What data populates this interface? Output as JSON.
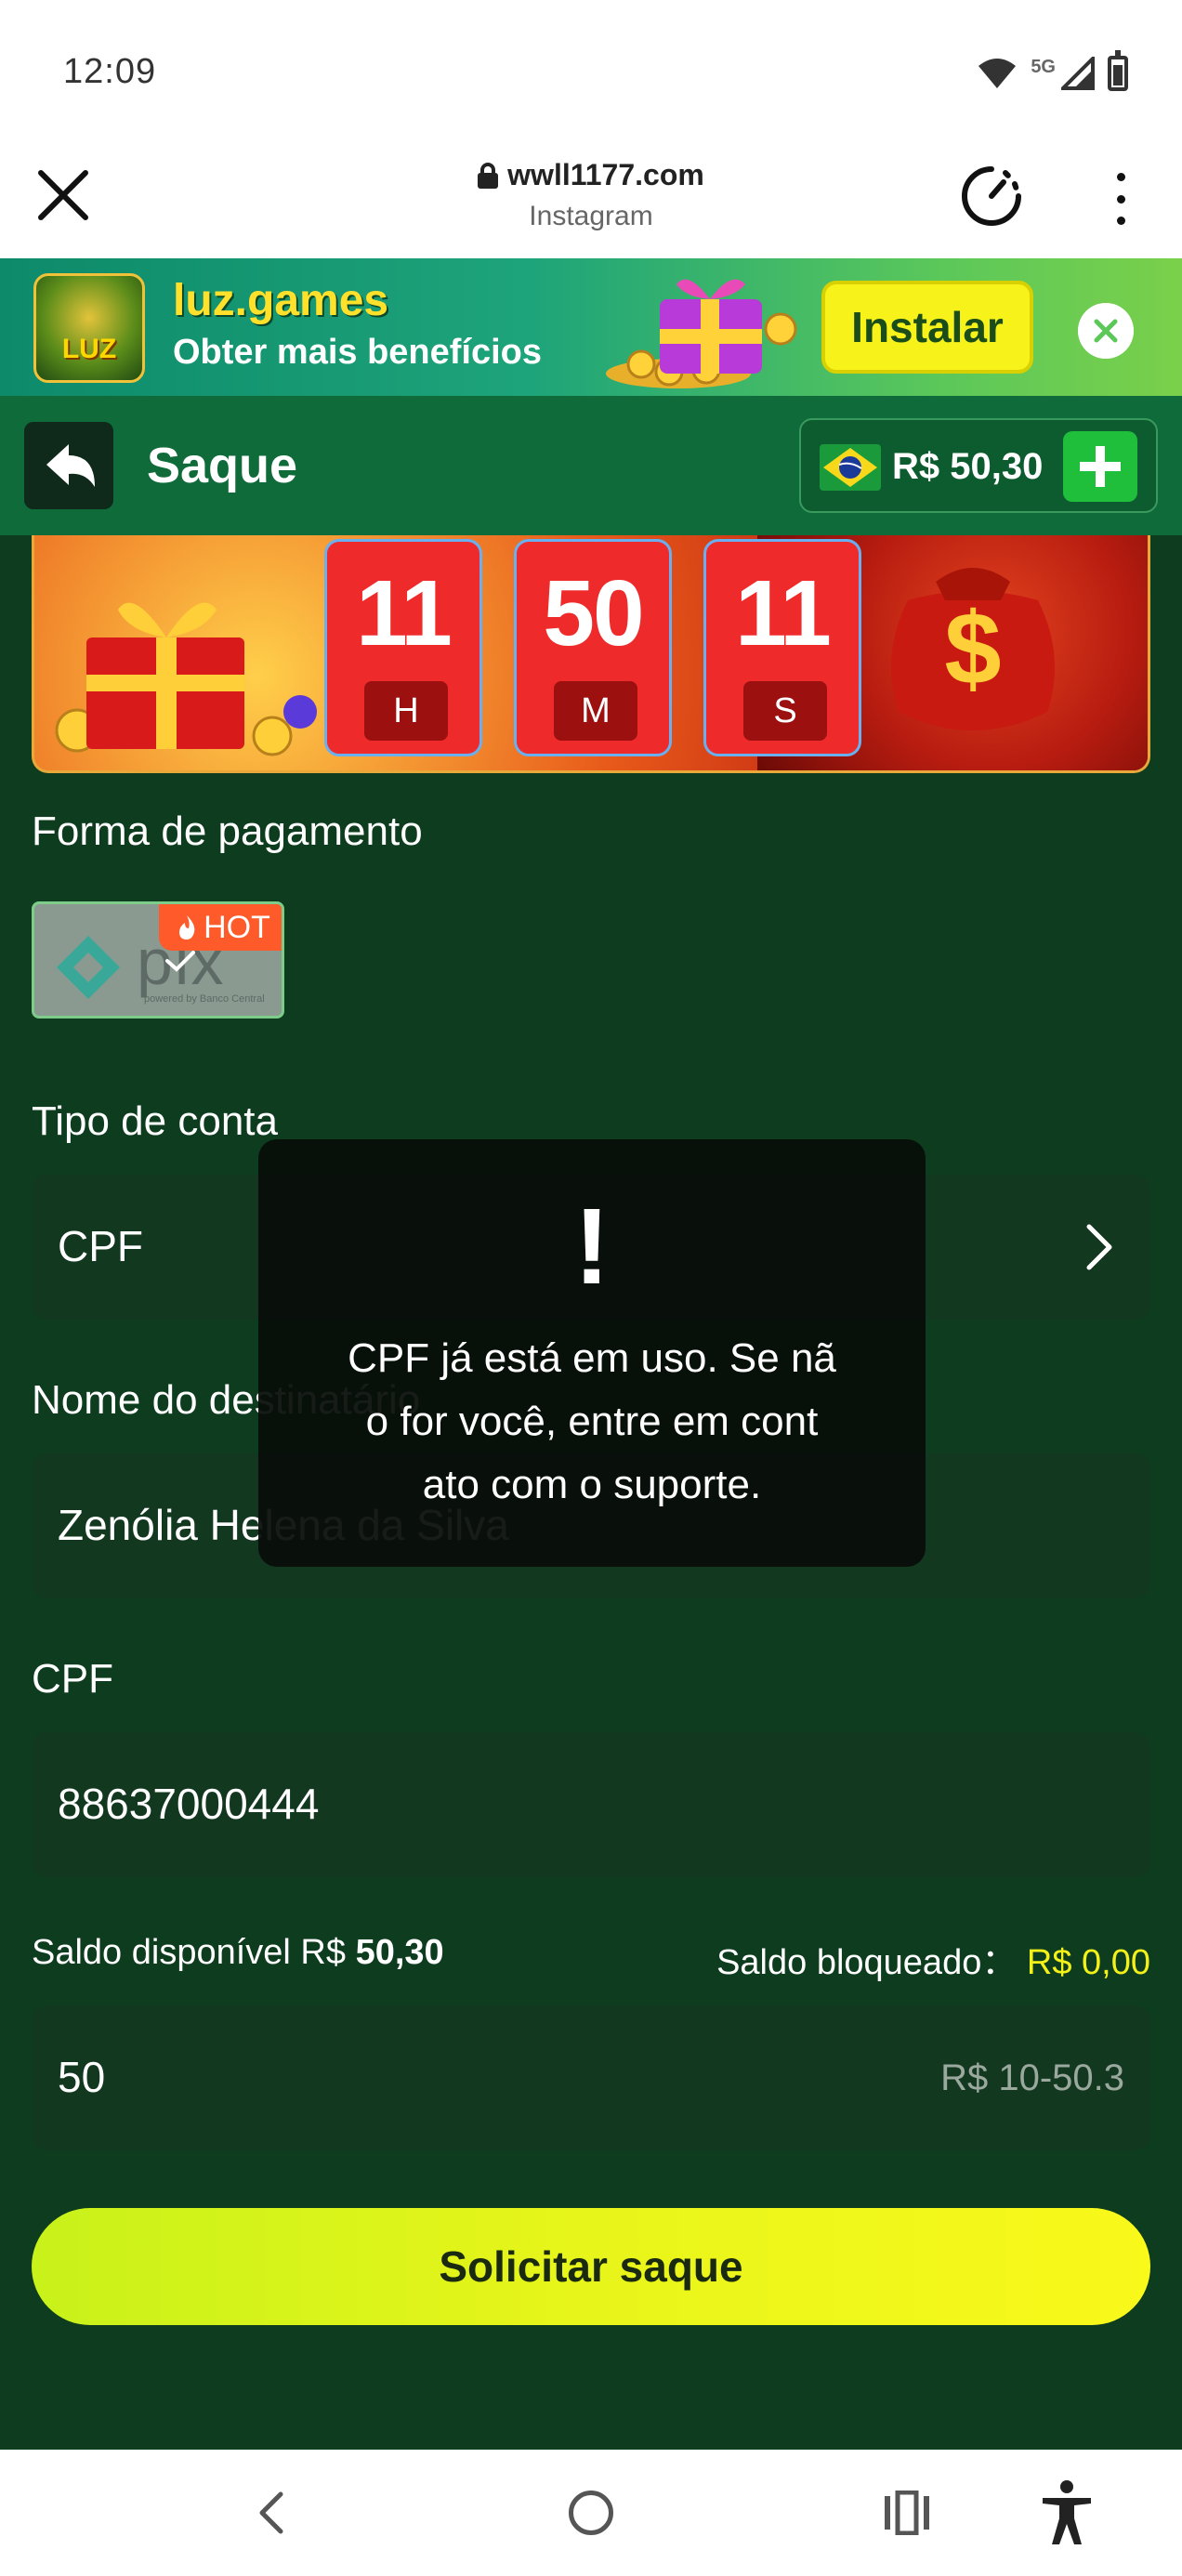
{
  "status_bar": {
    "time": "12:09",
    "network": "5G"
  },
  "browser": {
    "url": "wwll1177.com",
    "source": "Instagram"
  },
  "install_banner": {
    "app_name": "luz.games",
    "tagline": "Obter mais benefícios",
    "logo_text": "LUZ",
    "install_label": "Instalar"
  },
  "header": {
    "title": "Saque",
    "balance": "R$ 50,30"
  },
  "promo": {
    "hours": "11",
    "hours_unit": "H",
    "minutes": "50",
    "minutes_unit": "M",
    "seconds": "11",
    "seconds_unit": "S"
  },
  "payment": {
    "label": "Forma de pagamento",
    "method": "pix",
    "method_sub": "powered by Banco Central",
    "badge": "HOT"
  },
  "account_type": {
    "label": "Tipo de conta",
    "value": "CPF"
  },
  "recipient": {
    "label": "Nome do destinatário",
    "value": "Zenólia Helena da Silva"
  },
  "cpf": {
    "label": "CPF",
    "value": "88637000444"
  },
  "balances": {
    "available_label": "Saldo disponível R$",
    "available_value": "50,30",
    "blocked_label": "Saldo bloqueado：",
    "blocked_value": "R$ 0,00"
  },
  "amount": {
    "value": "50",
    "range_hint": "R$ 10-50.3"
  },
  "submit_label": "Solicitar saque",
  "toast": {
    "icon": "!",
    "line1": "CPF já está em uso. Se nã",
    "line2": "o for você, entre em cont",
    "line3": "ato com o suporte."
  },
  "colors": {
    "background": "#0d3d1e",
    "header": "#0f6b3a",
    "accent_button": "#e8f51a",
    "timer_red": "#ef2a2a",
    "blocked_value": "#f3f01a"
  }
}
